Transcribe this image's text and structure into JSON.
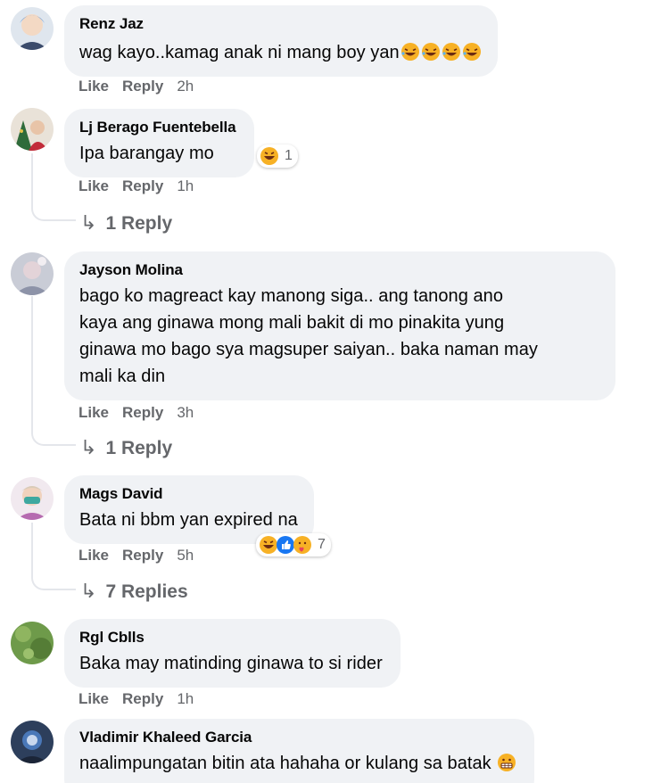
{
  "comments": [
    {
      "author": "Renz Jaz",
      "text": "wag kayo..kamag anak ni mang boy yan",
      "emojis": [
        "rolling-laugh",
        "rolling-laugh",
        "rolling-laugh",
        "rolling-laugh"
      ],
      "like_label": "Like",
      "reply_label": "Reply",
      "time": "2h"
    },
    {
      "author": "Lj Berago Fuentebella",
      "text": "Ipa barangay mo",
      "reaction_count": "1",
      "like_label": "Like",
      "reply_label": "Reply",
      "time": "1h",
      "replies_label": "1 Reply"
    },
    {
      "author": "Jayson Molina",
      "text_lines": [
        "bago ko magreact kay manong siga.. ang tanong ano",
        "kaya ang ginawa mong mali bakit di mo pinakita yung",
        "ginawa mo bago sya magsuper saiyan.. baka naman may",
        "mali ka din"
      ],
      "like_label": "Like",
      "reply_label": "Reply",
      "time": "3h",
      "replies_label": "1 Reply"
    },
    {
      "author": "Mags David",
      "text": "Bata ni bbm yan expired na",
      "reaction_count": "7",
      "like_label": "Like",
      "reply_label": "Reply",
      "time": "5h",
      "replies_label": "7 Replies"
    },
    {
      "author": "Rgl Cblls",
      "text": "Baka may matinding ginawa to si rider",
      "like_label": "Like",
      "reply_label": "Reply",
      "time": "1h"
    },
    {
      "author": "Vladimir Khaleed Garcia",
      "text": "naalimpungatan bitin ata hahaha or kulang sa batak",
      "emojis": [
        "grimace"
      ]
    }
  ],
  "colors": {
    "bubble": "#f0f2f5",
    "meta_text": "#65676b",
    "haha_yellow": "#f7b125",
    "like_blue": "#1877f2"
  },
  "icons": [
    "reply-arrow-icon",
    "haha-reaction-icon",
    "like-reaction-icon",
    "care-reaction-icon",
    "rolling-laugh-emoji-icon",
    "grimace-emoji-icon"
  ]
}
